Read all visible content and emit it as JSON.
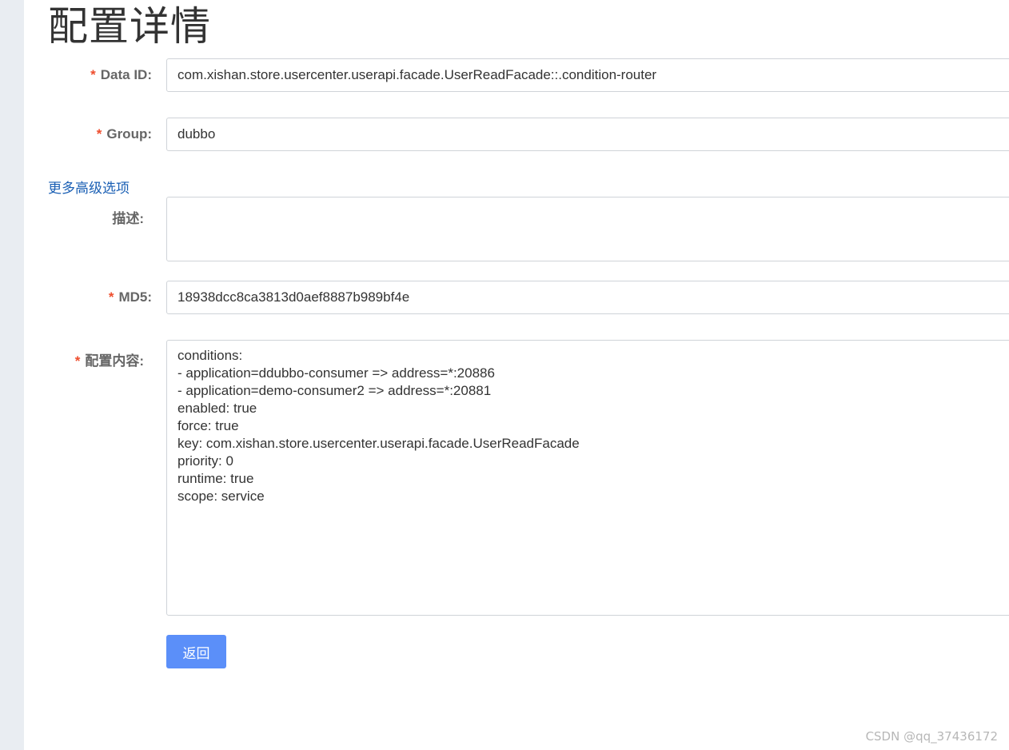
{
  "page": {
    "title": "配置详情"
  },
  "form": {
    "required_mark": "*",
    "data_id": {
      "label": "Data ID:",
      "value": "com.xishan.store.usercenter.userapi.facade.UserReadFacade::.condition-router"
    },
    "group": {
      "label": "Group:",
      "value": "dubbo"
    },
    "more_options_link": "更多高级选项",
    "description": {
      "label": "描述:",
      "value": ""
    },
    "md5": {
      "label": "MD5:",
      "value": "18938dcc8ca3813d0aef8887b989bf4e"
    },
    "content": {
      "label": "配置内容:",
      "lines": [
        "conditions:",
        "- application=ddubbo-consumer => address=*:20886",
        "- application=demo-consumer2 => address=*:20881",
        "enabled: true",
        "force: true",
        "key: com.xishan.store.usercenter.userapi.facade.UserReadFacade",
        "priority: 0",
        "runtime: true",
        "scope: service"
      ]
    },
    "back_button": "返回"
  },
  "watermark": "CSDN @qq_37436172"
}
